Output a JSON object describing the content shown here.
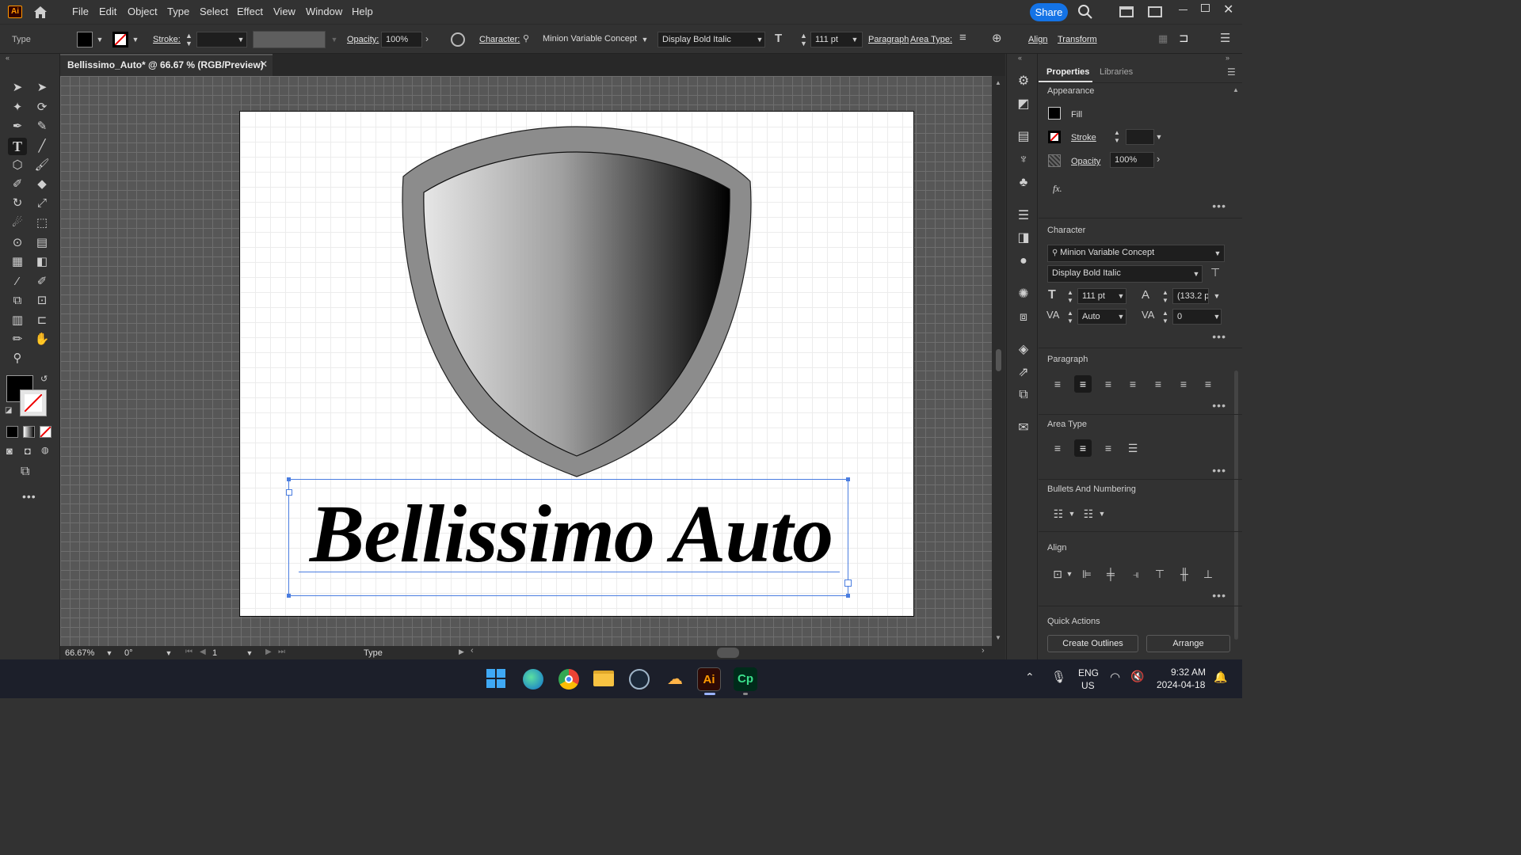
{
  "app": {
    "logo": "Ai",
    "home_icon": "home-icon"
  },
  "menu": [
    "File",
    "Edit",
    "Object",
    "Type",
    "Select",
    "Effect",
    "View",
    "Window",
    "Help"
  ],
  "header_right": {
    "share_label": "Share"
  },
  "control": {
    "mode_label": "Type",
    "stroke_label": "Stroke:",
    "opacity_label": "Opacity:",
    "opacity_value": "100%",
    "character_label": "Character:",
    "font_family": "Minion Variable Concept",
    "font_style": "Display Bold Italic",
    "font_size": "111 pt",
    "paragraph_label": "Paragraph",
    "area_type_label": "Area Type:",
    "align_label": "Align",
    "transform_label": "Transform"
  },
  "document": {
    "tab_title": "Bellissimo_Auto* @ 66.67 % (RGB/Preview)",
    "text": "Bellissimo Auto",
    "shield_gradient_light": "#e6e6e6",
    "shield_gradient_dark": "#000000",
    "shield_rim": "#8c8c8c"
  },
  "status": {
    "zoom": "66.67%",
    "rotation": "0°",
    "artboard": "1",
    "tool": "Type"
  },
  "panel": {
    "tabs": [
      "Properties",
      "Libraries"
    ],
    "appearance": {
      "title": "Appearance",
      "fill_label": "Fill",
      "stroke_label": "Stroke",
      "opacity_label": "Opacity",
      "opacity_value": "100%",
      "fx_label": "fx."
    },
    "character": {
      "title": "Character",
      "font_family": "Minion Variable Concept",
      "font_style": "Display Bold Italic",
      "size": "111 pt",
      "leading": "(133.2 p",
      "kerning": "Auto",
      "tracking": "0"
    },
    "paragraph_title": "Paragraph",
    "area_type_title": "Area Type",
    "bullets_title": "Bullets And Numbering",
    "align_title": "Align",
    "quick_actions": {
      "title": "Quick Actions",
      "create_outlines": "Create Outlines",
      "arrange": "Arrange"
    }
  },
  "taskbar": {
    "lang_top": "ENG",
    "lang_bottom": "US",
    "time": "9:32 AM",
    "date": "2024-04-18",
    "illustrator": "Ai",
    "captivate": "Cp"
  }
}
